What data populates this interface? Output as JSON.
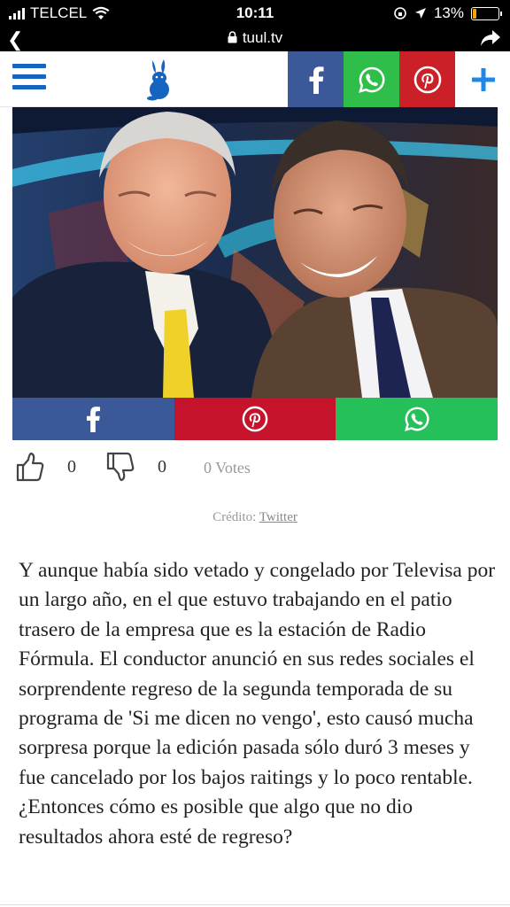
{
  "status_bar": {
    "carrier": "TELCEL",
    "time": "10:11",
    "battery": "13%",
    "battery_level": 0.13
  },
  "browser": {
    "url": "tuul.tv"
  },
  "header": {
    "share_icons": [
      "facebook-icon",
      "whatsapp-icon",
      "pinterest-icon",
      "plus-icon"
    ]
  },
  "share_bar": {
    "icons": [
      "facebook-icon",
      "pinterest-icon",
      "whatsapp-icon"
    ]
  },
  "votes": {
    "likes": "0",
    "dislikes": "0",
    "total": "0 Votes"
  },
  "credit": {
    "label": "Crédito:",
    "source": "Twitter"
  },
  "article": {
    "paragraph": "Y aunque había sido vetado y congelado por Televisa por un largo año, en el que estuvo trabajando en el patio trasero de la empresa que es la estación de Radio Fórmula. El conductor anunció en sus redes sociales el sorprendente regreso de la segunda temporada de su programa de 'Si me dicen no vengo', esto causó mucha sorpresa porque la edición pasada sólo duró 3 meses y fue cancelado por los bajos raitings y lo poco rentable. ¿Entonces cómo es posible que algo que no dio resultados ahora esté de regreso?"
  },
  "colors": {
    "facebook": "#3b5998",
    "whatsapp": "#2fbe4a",
    "pinterest": "#cb2027",
    "brand_blue": "#1565c0"
  }
}
